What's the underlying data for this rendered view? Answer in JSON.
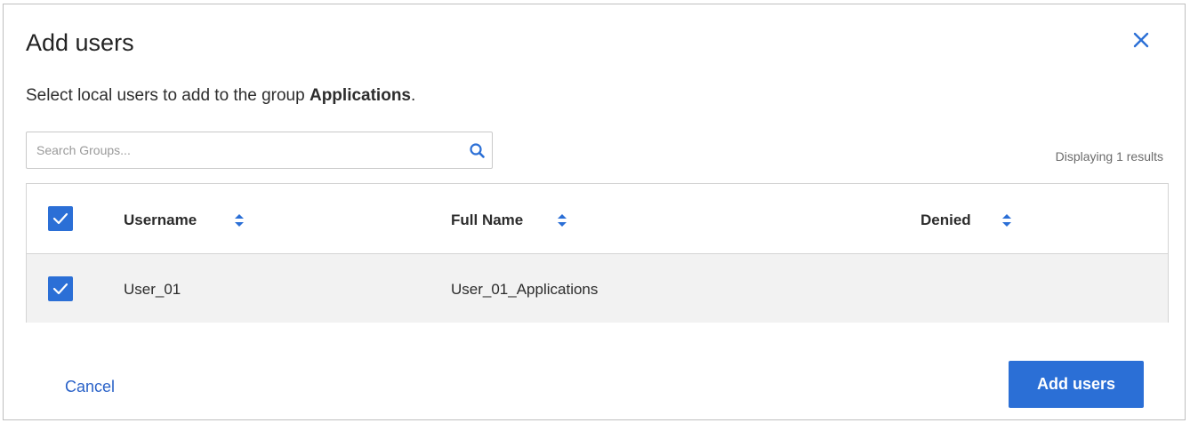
{
  "dialog": {
    "title": "Add users",
    "close_icon": "close-icon",
    "intro_text": "Select local users to add to the group ",
    "group_name": "Applications",
    "intro_suffix": "."
  },
  "search": {
    "placeholder": "Search Groups...",
    "icon": "search-icon"
  },
  "results_text": "Displaying 1 results",
  "table": {
    "select_all_checked": true,
    "columns": [
      {
        "label": "Username",
        "sort_icon": "sort-icon"
      },
      {
        "label": "Full Name",
        "sort_icon": "sort-icon"
      },
      {
        "label": "Denied",
        "sort_icon": "sort-icon"
      }
    ],
    "rows": [
      {
        "checked": true,
        "username": "User_01",
        "full_name": "User_01_Applications",
        "denied": ""
      }
    ]
  },
  "footer": {
    "cancel_label": "Cancel",
    "add_label": "Add users"
  },
  "colors": {
    "accent": "#2b6fd6",
    "link": "#2a62c8",
    "row_bg": "#f2f2f2"
  }
}
